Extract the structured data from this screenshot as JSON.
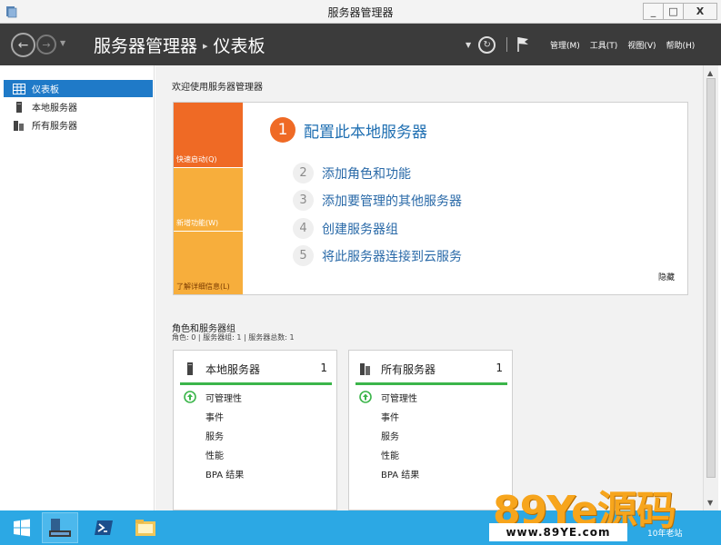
{
  "window": {
    "title": "服务器管理器",
    "minimize": "_",
    "maximize": "□",
    "close": "X"
  },
  "header": {
    "breadcrumb_root": "服务器管理器",
    "breadcrumb_sep": "▸",
    "breadcrumb_current": "仪表板",
    "menus": [
      "管理(M)",
      "工具(T)",
      "视图(V)",
      "帮助(H)"
    ]
  },
  "sidebar": {
    "items": [
      {
        "label": "仪表板",
        "icon": "dashboard-icon",
        "active": true
      },
      {
        "label": "本地服务器",
        "icon": "server-icon",
        "active": false
      },
      {
        "label": "所有服务器",
        "icon": "servers-icon",
        "active": false
      }
    ]
  },
  "welcome": {
    "title": "欢迎使用服务器管理器",
    "tiles": [
      "快速启动(Q)",
      "新增功能(W)",
      "了解详细信息(L)"
    ],
    "steps": [
      {
        "num": "1",
        "label": "配置此本地服务器"
      },
      {
        "num": "2",
        "label": "添加角色和功能"
      },
      {
        "num": "3",
        "label": "添加要管理的其他服务器"
      },
      {
        "num": "4",
        "label": "创建服务器组"
      },
      {
        "num": "5",
        "label": "将此服务器连接到云服务"
      }
    ],
    "hide": "隐藏"
  },
  "roles": {
    "title": "角色和服务器组",
    "summary": "角色: 0 | 服务器组: 1 | 服务器总数: 1",
    "cards": [
      {
        "name": "本地服务器",
        "count": "1",
        "rows": [
          "可管理性",
          "事件",
          "服务",
          "性能",
          "BPA 结果"
        ]
      },
      {
        "name": "所有服务器",
        "count": "1",
        "rows": [
          "可管理性",
          "事件",
          "服务",
          "性能",
          "BPA 结果"
        ]
      }
    ]
  },
  "colors": {
    "accent": "#1f7ac8",
    "orange": "#ef6a25",
    "amber": "#f7ae3c",
    "status_ok": "#3bb54a",
    "taskbar": "#2ca8e4"
  },
  "watermark": {
    "logo": "89Ye源码",
    "url": "www.89YE.com",
    "tag": "10年老站"
  }
}
